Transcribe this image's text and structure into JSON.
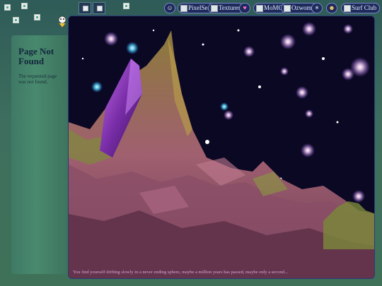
{
  "nav": {
    "links": [
      {
        "label": "PixelSea",
        "icon": "image-icon"
      },
      {
        "label": "Textures",
        "icon": "image-icon"
      },
      {
        "label": "MoMG",
        "icon": "image-icon"
      },
      {
        "label": "Ozwomp",
        "icon": "image-icon"
      },
      {
        "label": "Surf Club",
        "icon": "image-icon"
      }
    ]
  },
  "panel": {
    "title": "Page Not Found",
    "message": "The requested page was not found."
  },
  "scene": {
    "caption": "You find yourself drifting slowly in a never ending sphere, maybe a million years has passed, maybe only a second..."
  },
  "colors": {
    "background": "#3b6a5c",
    "nav_pill": "#1d2a5a",
    "caption": "#d9a2d8",
    "crystal": "#7a2ea8"
  }
}
